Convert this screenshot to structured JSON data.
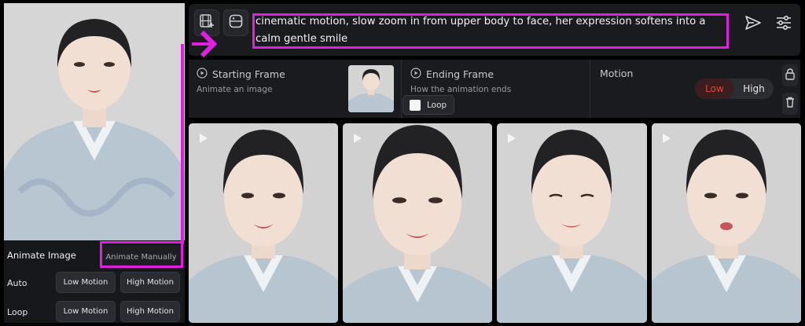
{
  "left_panel": {
    "title": "Animate Image",
    "manual_button": "Animate Manually",
    "rows": [
      {
        "label": "Auto",
        "low": "Low Motion",
        "high": "High Motion"
      },
      {
        "label": "Loop",
        "low": "Low Motion",
        "high": "High Motion"
      }
    ]
  },
  "prompt": {
    "text": "cinematic motion, slow zoom in from upper body to face, her expression softens into a calm gentle smile"
  },
  "frames": {
    "start_title": "Starting Frame",
    "start_sub": "Animate an image",
    "end_title": "Ending Frame",
    "end_sub": "How the animation ends",
    "loop_label": "Loop",
    "motion_title": "Motion",
    "motion_low": "Low",
    "motion_high": "High"
  },
  "colors": {
    "highlight": "#e020e0",
    "accent_red": "#e2453c",
    "panel_bg": "#1a1b1f"
  },
  "icons": [
    "video-add-icon",
    "image-frame-icon",
    "send-icon",
    "sliders-icon",
    "play-circle-icon",
    "lock-icon",
    "trash-icon",
    "play-icon"
  ]
}
